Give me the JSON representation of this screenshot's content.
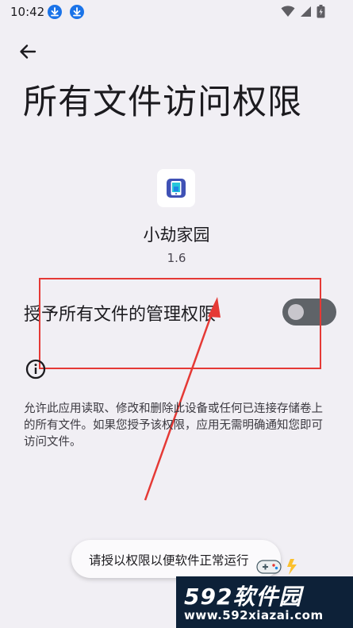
{
  "status_bar": {
    "time": "10:42"
  },
  "header": {
    "title": "所有文件访问权限"
  },
  "app": {
    "name": "小劫家园",
    "version": "1.6"
  },
  "permission": {
    "label": "授予所有文件的管理权限",
    "enabled": false
  },
  "info": {
    "description": "允许此应用读取、修改和删除此设备或任何已连接存储卷上的所有文件。如果您授予该权限，应用无需明确通知您即可访问文件。"
  },
  "toast": {
    "message": "请授以权限以便软件正常运行"
  },
  "watermark": {
    "logo_num": "592",
    "logo_text": "软件园",
    "url": "www.592xiazai.com"
  },
  "colors": {
    "background": "#f1eff4",
    "accent_blue": "#1a73e8",
    "annotation_red": "#e53935",
    "toggle_off": "#5f6368",
    "watermark_bg": "#0d2138"
  }
}
